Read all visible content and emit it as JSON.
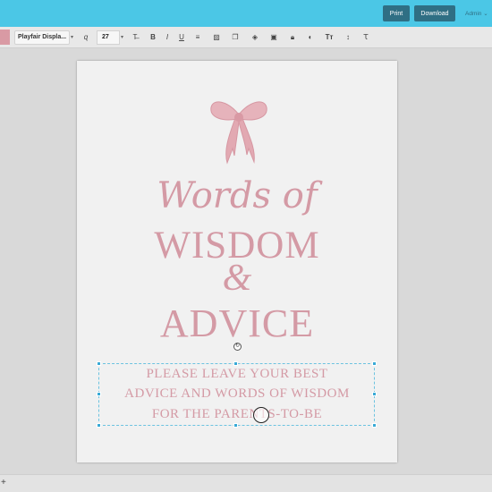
{
  "topbar": {
    "print_label": "Print",
    "download_label": "Download",
    "user_label": "Admin ⌄"
  },
  "toolbar": {
    "font_family": "Playfair Displa...",
    "font_size": "27",
    "icons": [
      "text-color-icon",
      "strikethrough-icon",
      "bold-icon",
      "italic-icon",
      "underline-icon",
      "align-icon",
      "image-icon",
      "copy-icon",
      "layers-icon",
      "delete-icon",
      "lock-icon",
      "opacity-icon",
      "text-transform-icon",
      "line-height-icon",
      "clear-format-icon"
    ],
    "swatch_color": "#d99aa4"
  },
  "page": {
    "script_title": "Words of",
    "line1": "WISDOM",
    "amp": "&",
    "line2": "ADVICE",
    "sub1": "PLEASE LEAVE YOUR BEST",
    "sub2": "ADVICE AND WORDS OF WISDOM",
    "sub3": "FOR THE PARENTS-TO-BE",
    "accent_color": "#d49aa5"
  },
  "bottom": {
    "add_label": "+"
  }
}
